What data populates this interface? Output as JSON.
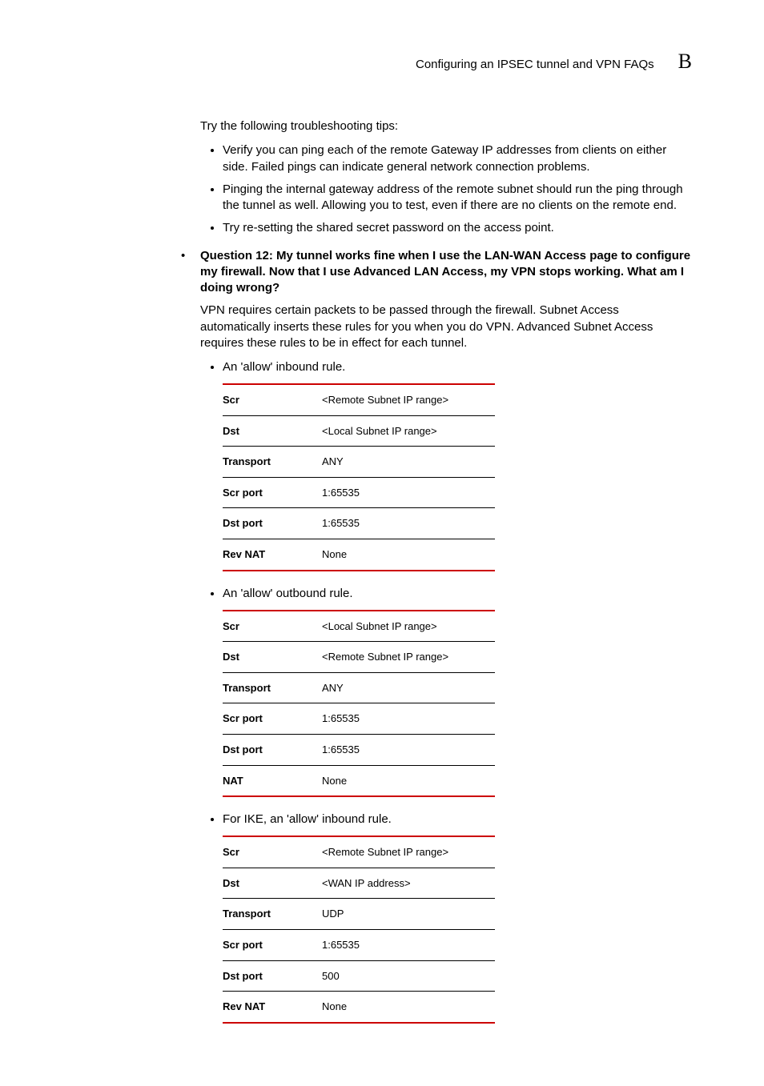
{
  "header": {
    "title": "Configuring an IPSEC tunnel and VPN FAQs",
    "appendix": "B"
  },
  "intro": "Try the following troubleshooting tips:",
  "tips": [
    "Verify you can ping each of the remote Gateway IP addresses from clients on either side. Failed pings can indicate general network connection problems.",
    "Pinging the internal gateway address of the remote subnet should run the ping through the tunnel as well. Allowing you to test, even if there are no clients on the remote end.",
    "Try re-setting the shared secret password on the access point."
  ],
  "question": "Question 12: My tunnel works fine when I use the LAN-WAN Access page to configure my firewall. Now that I use Advanced LAN Access, my VPN stops working. What am I doing wrong?",
  "answer": "VPN requires certain packets to be passed through the firewall. Subnet Access automatically inserts these rules for you when you do VPN. Advanced Subnet Access requires these rules to be in effect for each tunnel.",
  "rules": [
    {
      "label": "An 'allow' inbound rule.",
      "rows": [
        {
          "k": "Scr",
          "v": "<Remote Subnet IP range>"
        },
        {
          "k": "Dst",
          "v": "<Local Subnet IP range>"
        },
        {
          "k": "Transport",
          "v": "ANY"
        },
        {
          "k": "Scr port",
          "v": "1:65535"
        },
        {
          "k": "Dst port",
          "v": "1:65535"
        },
        {
          "k": "Rev NAT",
          "v": "None"
        }
      ]
    },
    {
      "label": "An 'allow' outbound rule.",
      "rows": [
        {
          "k": "Scr",
          "v": "<Local Subnet IP range>"
        },
        {
          "k": "Dst",
          "v": "<Remote Subnet IP range>"
        },
        {
          "k": "Transport",
          "v": "ANY"
        },
        {
          "k": "Scr port",
          "v": "1:65535"
        },
        {
          "k": "Dst port",
          "v": "1:65535"
        },
        {
          "k": "NAT",
          "v": "None"
        }
      ]
    },
    {
      "label": "For IKE, an 'allow' inbound rule.",
      "rows": [
        {
          "k": "Scr",
          "v": "<Remote Subnet IP range>"
        },
        {
          "k": "Dst",
          "v": "<WAN IP address>"
        },
        {
          "k": "Transport",
          "v": "UDP"
        },
        {
          "k": "Scr port",
          "v": "1:65535"
        },
        {
          "k": "Dst port",
          "v": "500"
        },
        {
          "k": "Rev NAT",
          "v": "None"
        }
      ]
    }
  ]
}
